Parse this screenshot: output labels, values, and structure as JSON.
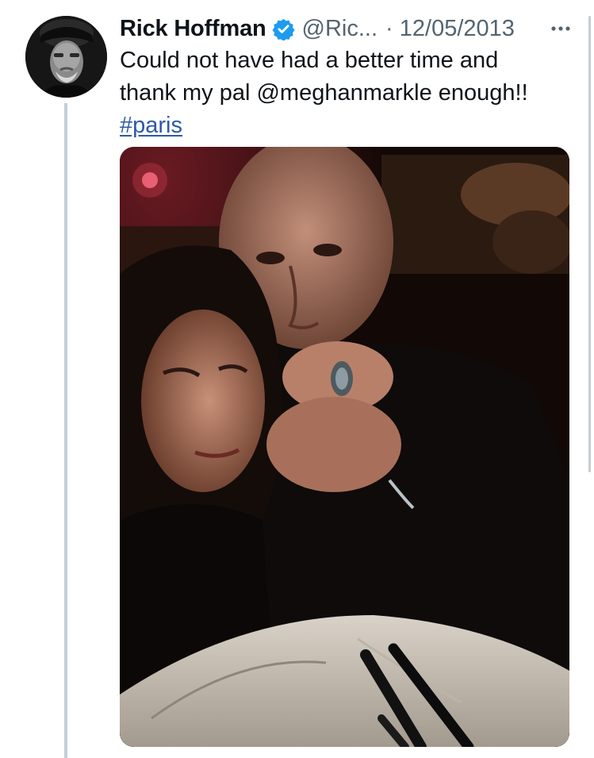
{
  "tweet": {
    "author_name": "Rick Hoffman",
    "handle": "@Ric...",
    "date_separator": "·",
    "date": "12/05/2013",
    "text_line_1": "Could not have had a better time and",
    "text_line_2": "thank my pal @meghanmarkle enough!!",
    "hashtag": "#paris"
  },
  "icons": {
    "verified": "verified-badge-icon",
    "more": "more-options-icon"
  },
  "colors": {
    "verified": "#1d9bf0",
    "hashtag": "#2c5aa8",
    "thread_line": "#c4cfd6"
  }
}
